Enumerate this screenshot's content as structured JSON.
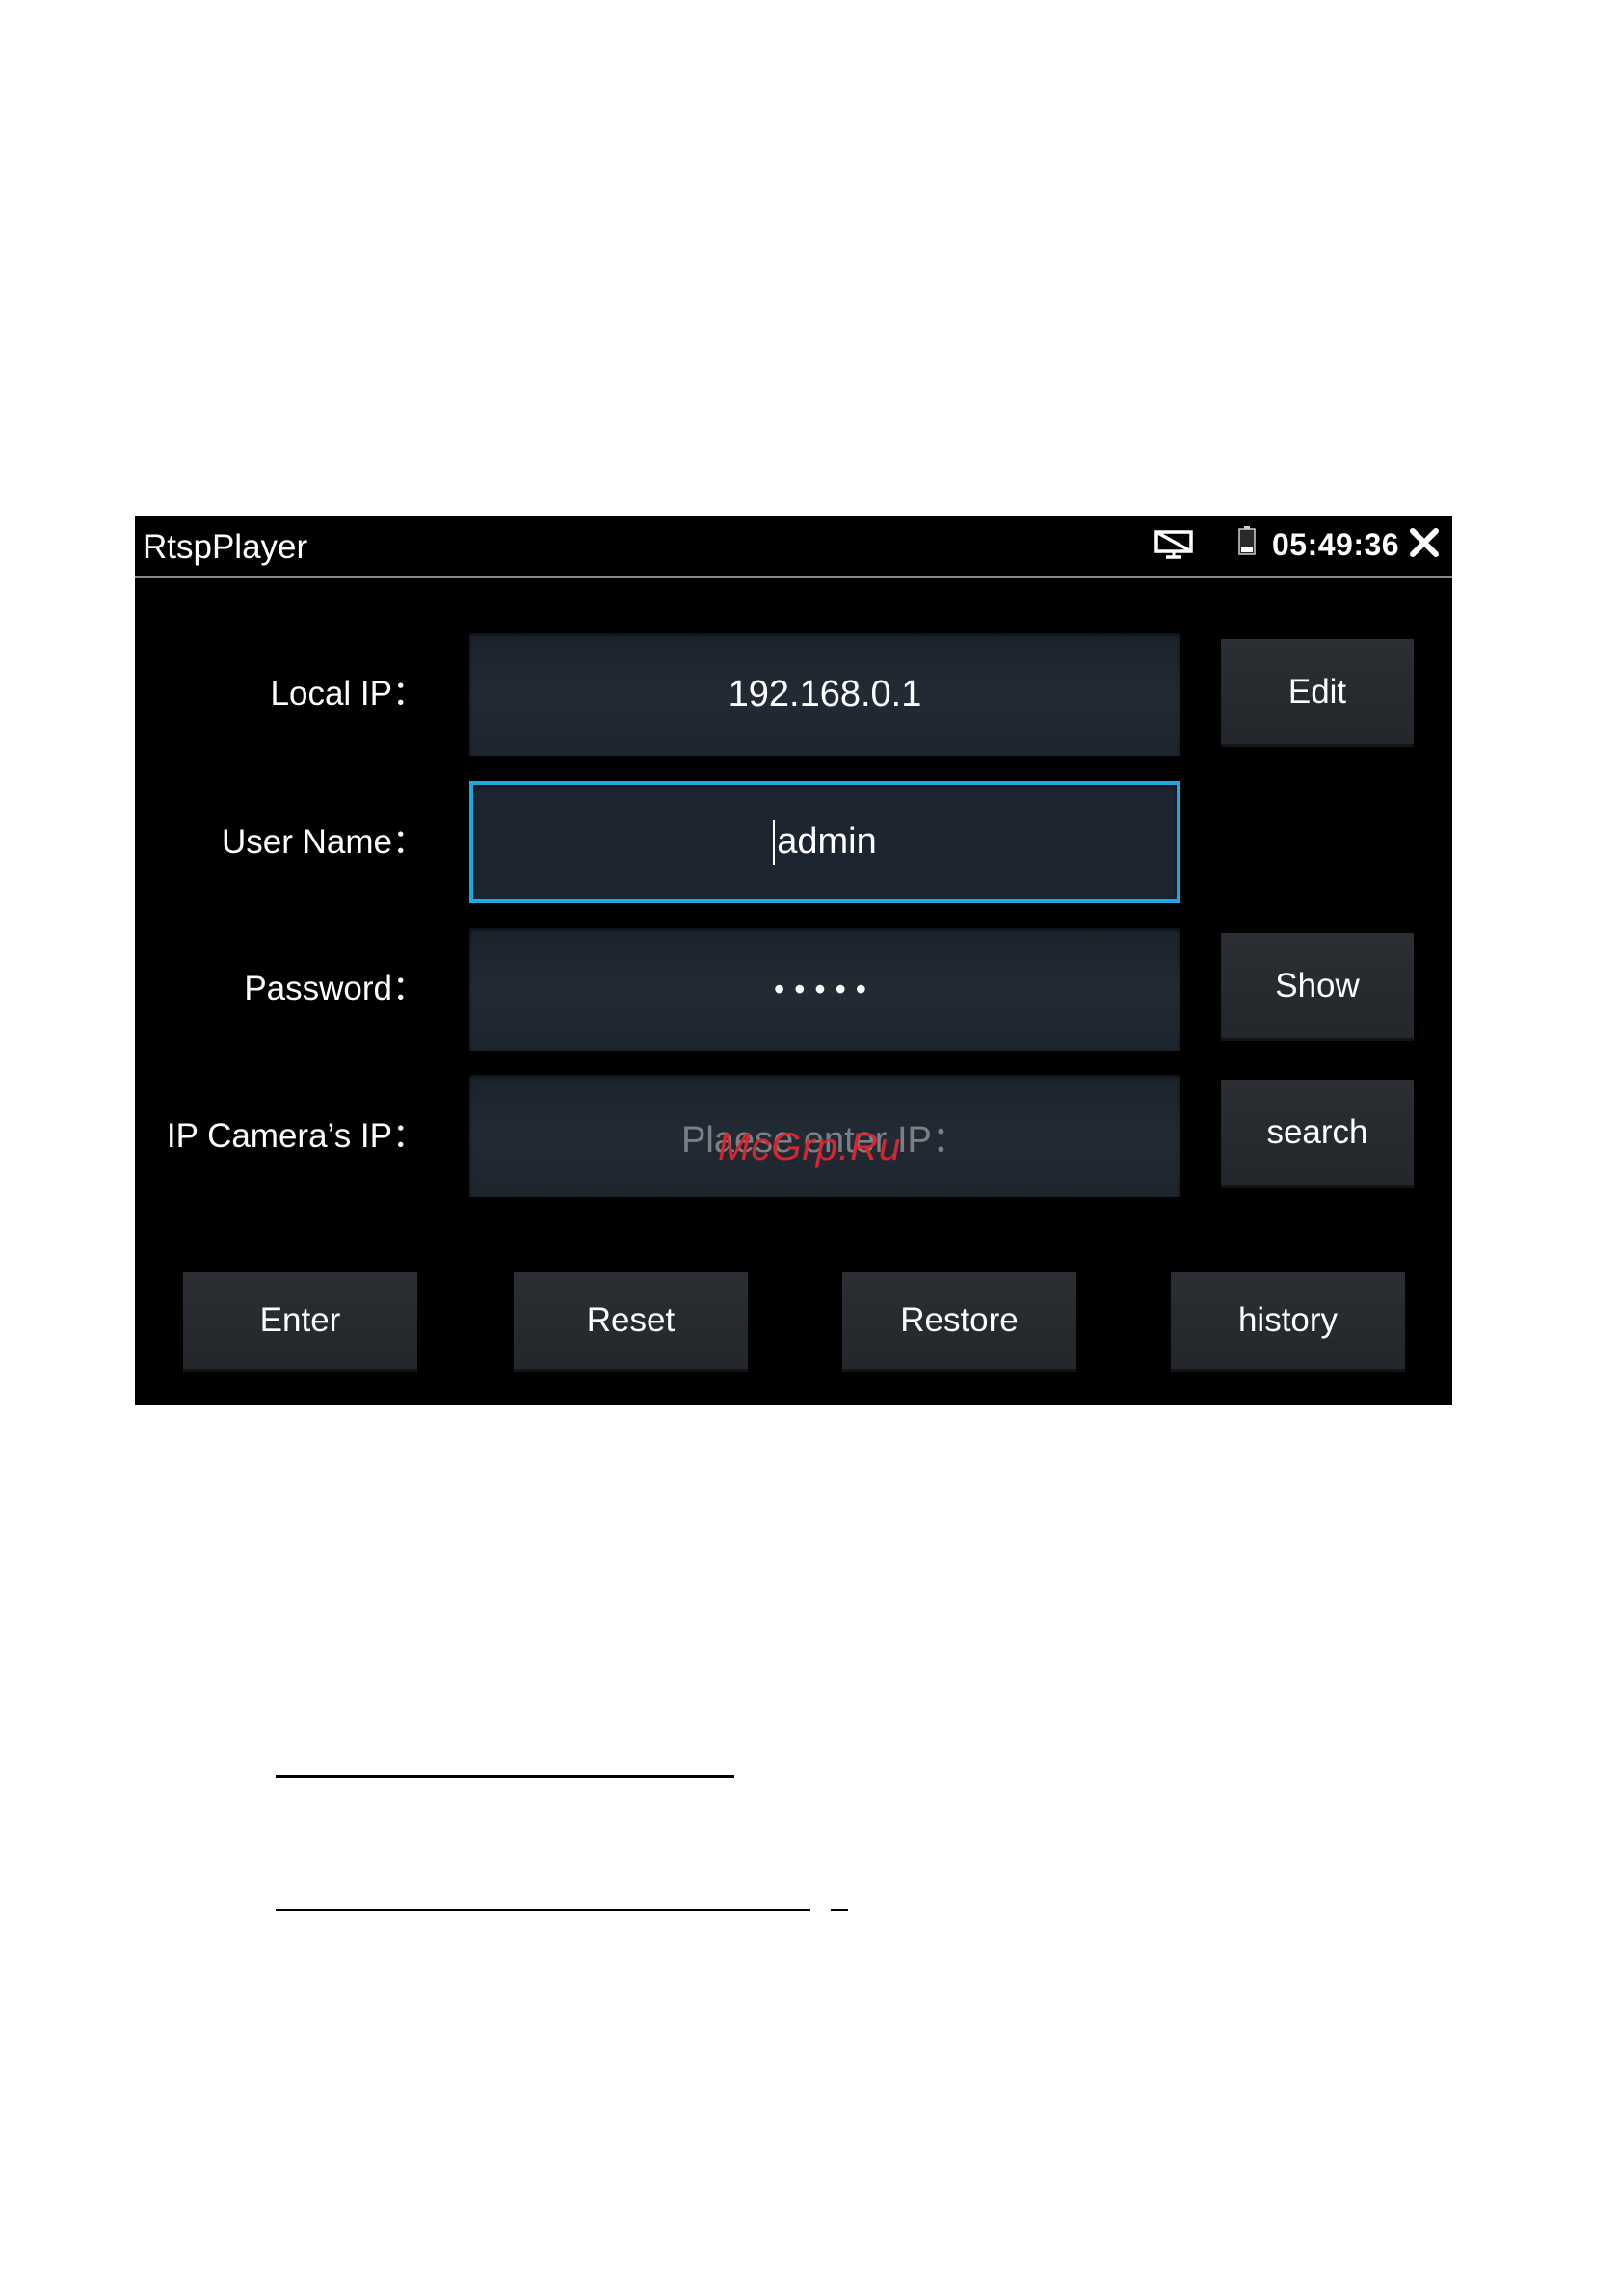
{
  "window": {
    "title": "RtspPlayer",
    "clock": "05:49:36",
    "icons": {
      "screen": "screen-off-icon",
      "battery": "battery-icon",
      "close": "close-icon"
    }
  },
  "form": {
    "local_ip": {
      "label": "Local IP：",
      "value": "192.168.0.1",
      "button": "Edit"
    },
    "user_name": {
      "label": "User Name：",
      "value": "admin"
    },
    "password": {
      "label": "Password：",
      "value": "•••••",
      "button": "Show"
    },
    "camera_ip": {
      "label": "IP Camera’s IP：",
      "placeholder": "Plaese enter IP：",
      "button": "search"
    }
  },
  "actions": {
    "enter": "Enter",
    "reset": "Reset",
    "restore": "Restore",
    "history": "history"
  },
  "watermark": "McGrp.Ru",
  "colors": {
    "focus": "#1aa9e0",
    "watermark": "#d8262e"
  }
}
